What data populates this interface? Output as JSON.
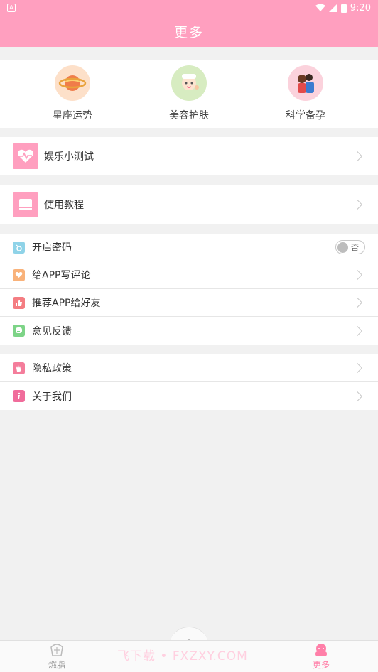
{
  "status": {
    "time": "9:20"
  },
  "header": {
    "title": "更多"
  },
  "top_grid": [
    {
      "label": "星座运势",
      "icon": "planet-icon"
    },
    {
      "label": "美容护肤",
      "icon": "beauty-face-icon"
    },
    {
      "label": "科学备孕",
      "icon": "couple-icon"
    }
  ],
  "rows": {
    "quiz": {
      "label": "娱乐小测试",
      "icon": "heartbeat-icon"
    },
    "tutorial": {
      "label": "使用教程",
      "icon": "book-icon"
    }
  },
  "settings": {
    "password": {
      "label": "开启密码",
      "toggle_text": "否"
    },
    "review": {
      "label": "给APP写评论"
    },
    "recommend": {
      "label": "推荐APP给好友"
    },
    "feedback": {
      "label": "意见反馈"
    }
  },
  "about": {
    "privacy": {
      "label": "隐私政策"
    },
    "about_us": {
      "label": "关于我们"
    }
  },
  "tabbar": {
    "left": "燃脂",
    "right": "更多",
    "watermark": "飞下载 • FXZXY.COM"
  },
  "colors": {
    "brand": "#ff9fbf",
    "active_tab": "#ff7fa8"
  }
}
